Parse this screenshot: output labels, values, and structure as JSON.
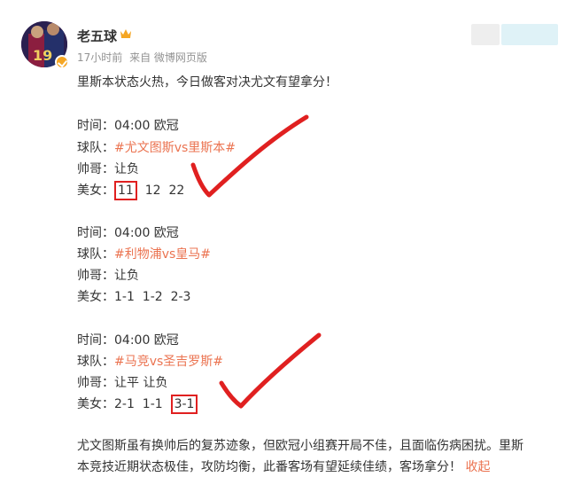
{
  "user": {
    "name": "老五球",
    "time": "17小时前",
    "source": "来自 微博网页版"
  },
  "post": {
    "intro": "里斯本状态火热，今日做客对决尤文有望拿分！",
    "matches": [
      {
        "time_label": "时间：",
        "time_value": "04:00 欧冠",
        "team_label": "球队：",
        "team_value": "#尤文图斯vs里斯本#",
        "shuai_label": "帅哥：",
        "shuai_value": "让负",
        "meinv_label": "美女：",
        "picks": [
          "11",
          "12",
          "22"
        ]
      },
      {
        "time_label": "时间：",
        "time_value": "04:00 欧冠",
        "team_label": "球队：",
        "team_value": "#利物浦vs皇马#",
        "shuai_label": "帅哥：",
        "shuai_value": "让负",
        "meinv_label": "美女：",
        "picks": [
          "1-1",
          "1-2",
          "2-3"
        ]
      },
      {
        "time_label": "时间：",
        "time_value": "04:00 欧冠",
        "team_label": "球队：",
        "team_value": "#马竞vs圣吉罗斯#",
        "shuai_label": "帅哥：",
        "shuai_value": "让平 让负",
        "meinv_label": "美女：",
        "picks": [
          "2-1",
          "1-1",
          "3-1"
        ]
      }
    ],
    "summary_line1": "尤文图斯虽有换帅后的复苏迹象，但欧冠小组赛开局不佳，且面临伤病困扰。里斯",
    "summary_line2": "本竞技近期状态极佳，攻防均衡，此番客场有望延续佳绩，客场拿分！",
    "fold_label": "收起"
  },
  "colors": {
    "accent": "#eb7350",
    "annotation": "#e02020",
    "meta": "#939393"
  }
}
